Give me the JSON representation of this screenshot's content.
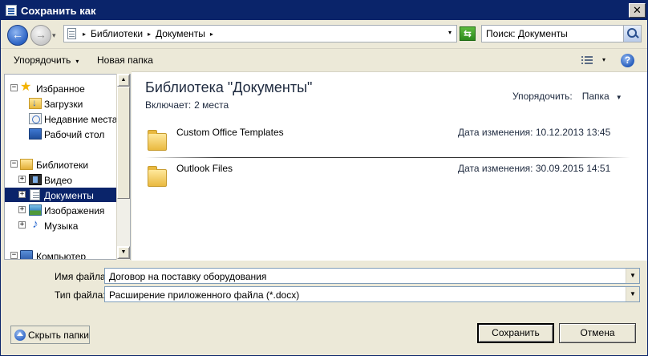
{
  "window": {
    "title": "Сохранить как",
    "close_glyph": "✕"
  },
  "navigation": {
    "back_glyph": "←",
    "forward_glyph": "→",
    "history_glyph": "▾",
    "breadcrumbs": [
      "Библиотеки",
      "Документы"
    ],
    "crumb_separator": "▸",
    "address_dropdown": "▾",
    "refresh_glyph": "⇆",
    "search_placeholder": "Поиск: Документы"
  },
  "toolbar": {
    "organize_label": "Упорядочить",
    "organize_arrow": "▾",
    "new_folder_label": "Новая папка",
    "view_arrow": "▾",
    "help_glyph": "?"
  },
  "sidebar": {
    "groups": [
      {
        "label": "Избранное",
        "expander": "−",
        "icon": "star-icon",
        "items": [
          {
            "label": "Загрузки",
            "icon": "downloads-icon"
          },
          {
            "label": "Недавние места",
            "icon": "recent-places-icon"
          },
          {
            "label": "Рабочий стол",
            "icon": "desktop-icon"
          }
        ]
      },
      {
        "label": "Библиотеки",
        "expander": "−",
        "icon": "libraries-icon",
        "items": [
          {
            "label": "Видео",
            "icon": "video-icon",
            "expander": "+"
          },
          {
            "label": "Документы",
            "icon": "documents-icon",
            "expander": "+",
            "selected": true
          },
          {
            "label": "Изображения",
            "icon": "pictures-icon",
            "expander": "+"
          },
          {
            "label": "Музыка",
            "icon": "music-icon",
            "expander": "+"
          }
        ]
      },
      {
        "label": "Компьютер",
        "expander": "−",
        "icon": "computer-icon",
        "items": []
      }
    ],
    "scroll_up": "▲",
    "scroll_down": "▼"
  },
  "content": {
    "library_title": "Библиотека \"Документы\"",
    "includes_label": "Включает:",
    "includes_value": "2 места",
    "arrange_label": "Упорядочить:",
    "arrange_value": "Папка",
    "arrange_arrow": "▼",
    "files": [
      {
        "name": "Custom Office Templates",
        "modified_label": "Дата изменения:",
        "modified": "10.12.2013 13:45",
        "icon": "folder-icon"
      },
      {
        "name": "Outlook Files",
        "modified_label": "Дата изменения:",
        "modified": "30.09.2015 14:51",
        "icon": "folder-icon"
      }
    ]
  },
  "form": {
    "filename_label": "Имя файла:",
    "filename_value": "Договор на поставку оборудования",
    "filetype_label": "Тип файла:",
    "filetype_value": "Расширение приложенного файла (*.docx)",
    "combo_arrow": "▼"
  },
  "footer": {
    "hide_folders_label": "Скрыть папки",
    "save_label": "Сохранить",
    "cancel_label": "Отмена"
  }
}
